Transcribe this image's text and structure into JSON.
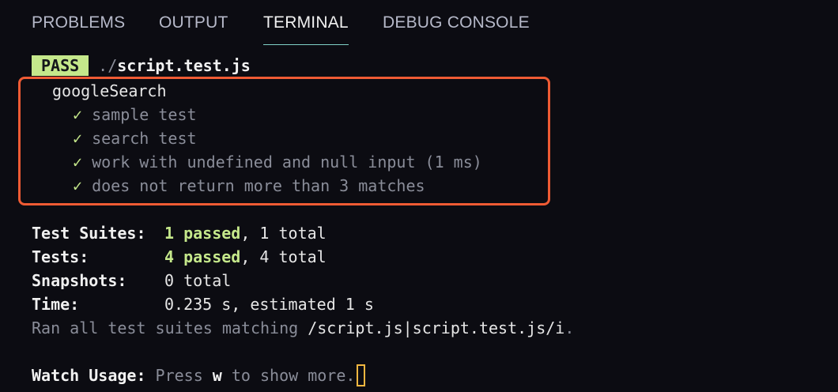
{
  "panel": {
    "tabs": [
      {
        "label": "PROBLEMS"
      },
      {
        "label": "OUTPUT"
      },
      {
        "label": "TERMINAL"
      },
      {
        "label": "DEBUG CONSOLE"
      }
    ],
    "active_tab": "TERMINAL"
  },
  "terminal": {
    "pass_badge": "PASS",
    "file_dir": "./",
    "file_name": "script.test.js",
    "suite_name": "googleSearch",
    "tests": [
      {
        "check": "✓",
        "name": "sample test"
      },
      {
        "check": "✓",
        "name": "search test"
      },
      {
        "check": "✓",
        "name": "work with undefined and null input (1 ms)"
      },
      {
        "check": "✓",
        "name": "does not return more than 3 matches"
      }
    ],
    "summary": {
      "suites_label": "Test Suites:",
      "suites_passed": "1 passed",
      "suites_rest": ", 1 total",
      "tests_label": "Tests:",
      "tests_passed": "4 passed",
      "tests_rest": ", 4 total",
      "snapshots_label": "Snapshots:",
      "snapshots_value": "0 total",
      "time_label": "Time:",
      "time_value": "0.235 s, estimated 1 s",
      "ran_prefix": "Ran all test suites matching ",
      "ran_pattern": "/script.js|script.test.js/i",
      "ran_suffix": "."
    },
    "watch": {
      "label": "Watch Usage:",
      "press": " Press ",
      "key": "w",
      "rest": " to show more."
    }
  },
  "colors": {
    "background": "#0c0c12",
    "pass_badge_bg": "#c5e88b",
    "highlight_border": "#ef5b34",
    "active_tab_underline": "#7fd1c7",
    "cursor": "#f4b740"
  }
}
